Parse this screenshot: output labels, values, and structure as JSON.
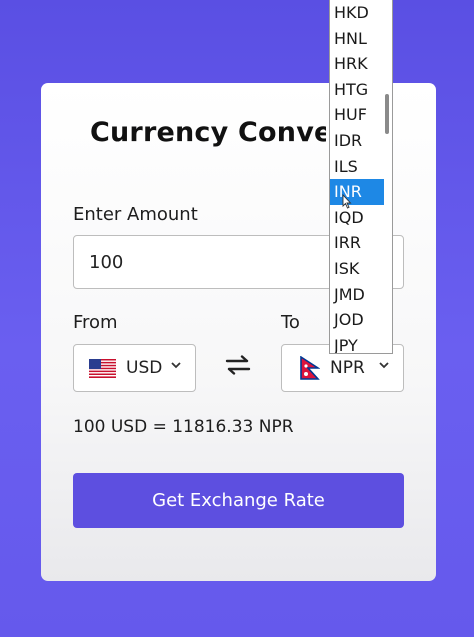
{
  "app": {
    "title": "Currency Converter",
    "amount_label": "Enter Amount",
    "amount_value": "100",
    "from_label": "From",
    "to_label": "To",
    "from_currency": "USD",
    "to_currency": "NPR",
    "result_text": "100 USD = 11816.33 NPR",
    "button_label": "Get Exchange Rate"
  },
  "dropdown": {
    "options": [
      "HKD",
      "HNL",
      "HRK",
      "HTG",
      "HUF",
      "IDR",
      "ILS",
      "INR",
      "IQD",
      "IRR",
      "ISK",
      "JMD",
      "JOD",
      "JPY"
    ],
    "selected": "INR"
  },
  "icons": {
    "from_flag": "us-flag-icon",
    "to_flag": "nepal-flag-icon",
    "swap": "swap-arrows-icon",
    "chevron": "chevron-down-icon"
  },
  "colors": {
    "background": "#5a4fe3",
    "button": "#5d4fe0",
    "selected_option": "#1e88e5"
  }
}
